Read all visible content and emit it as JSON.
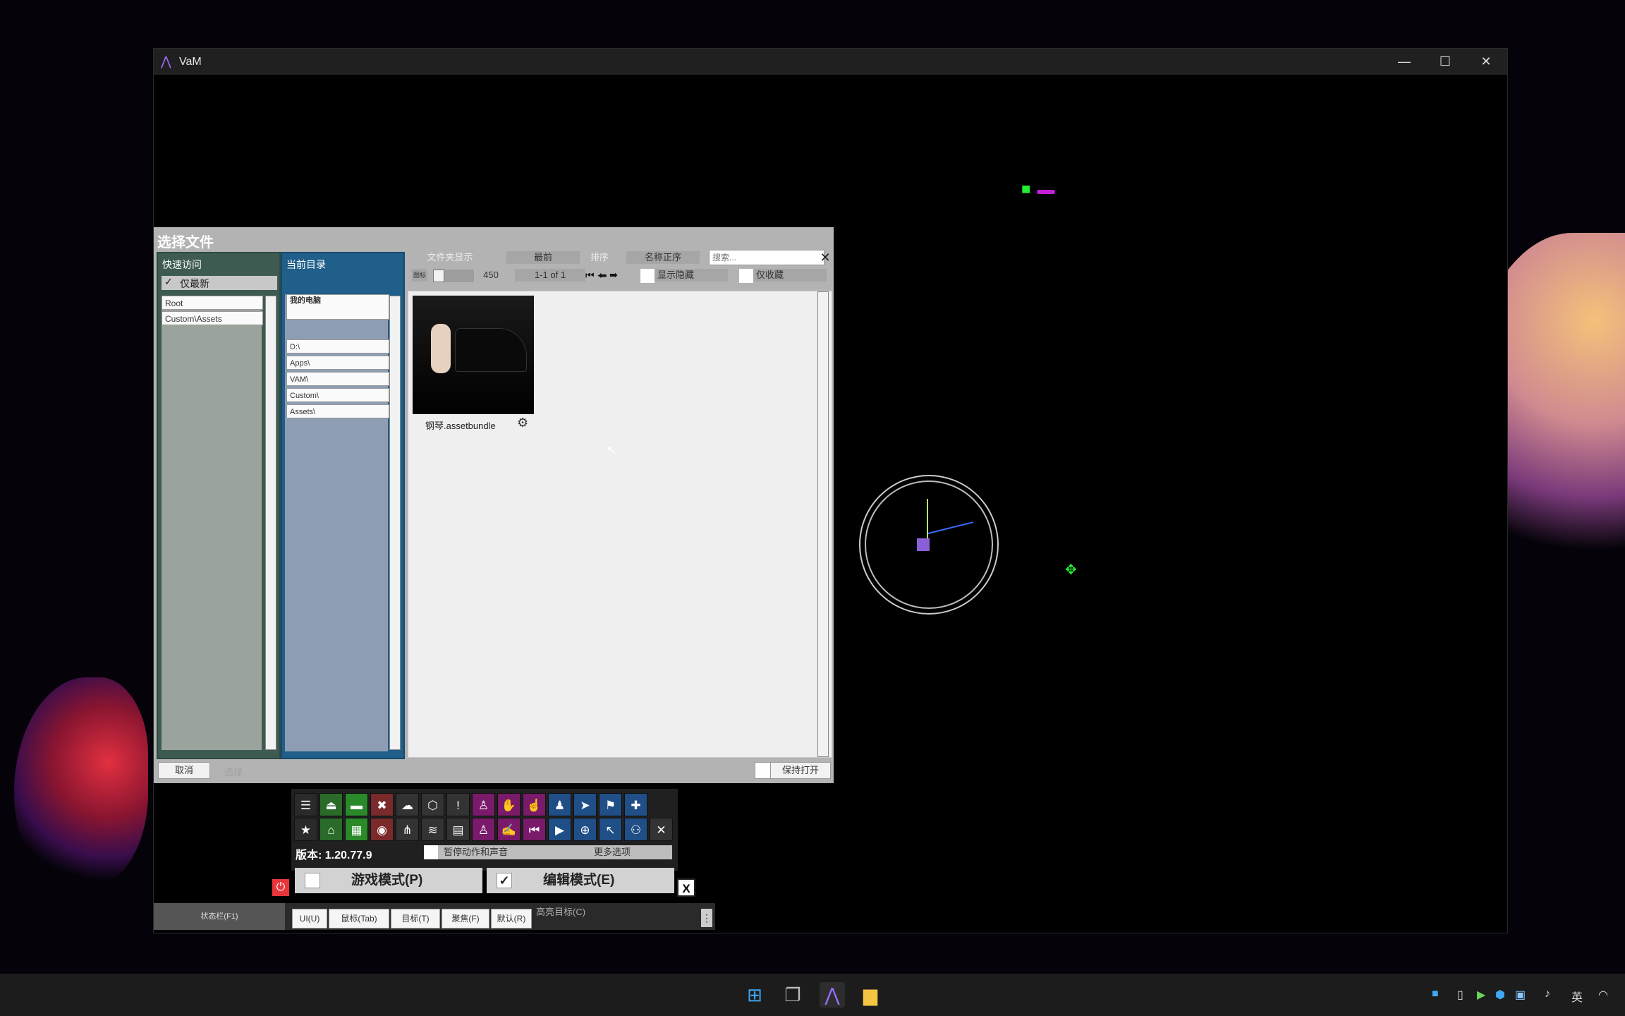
{
  "window": {
    "title": "VaM",
    "app_icon": "vam-logo-icon",
    "controls": [
      "minimize-icon",
      "maximize-icon",
      "close-icon"
    ]
  },
  "dialog": {
    "title": "选择文件",
    "quick_access": {
      "label": "快速访问",
      "checkbox_label": "仅最新",
      "checked": true,
      "items": [
        "Root",
        "Custom\\Assets"
      ]
    },
    "current_dir": {
      "label": "当前目录",
      "header_item": "我的电脑",
      "items": [
        "D:\\",
        "Apps\\",
        "VAM\\",
        "Custom\\",
        "Assets\\"
      ]
    },
    "toolbar": {
      "folder_view": "文件夹显示",
      "recent": "最前",
      "sort_label": "排序",
      "sort_value": "名称正序",
      "search_placeholder": "搜索...",
      "size_label": "图标",
      "size_value": "450",
      "page_info": "1-1 of 1",
      "show_hidden": "显示隐藏",
      "only_fav": "仅收藏"
    },
    "files": [
      {
        "name": "钢琴.assetbundle",
        "icon": "gear-icon"
      }
    ],
    "cancel": "取消",
    "select_label": "选择",
    "keep_open": "保持打开"
  },
  "panel": {
    "version": "版本: 1.20.77.9",
    "pause": "暂停动作和声音",
    "more": "更多选项",
    "play_mode": "游戏模式(P)",
    "edit_mode": "编辑模式(E)",
    "edit_checked": true,
    "close": "X",
    "icons_row1": [
      "menu-icon",
      "open-scene-icon",
      "folder-icon",
      "delete-icon",
      "cloud-upload-icon",
      "package-icon",
      "alert-icon",
      "person-add-icon",
      "hand-icon",
      "pointer-hand-icon",
      "person-icon",
      "send-icon",
      "flag-icon",
      "plus-icon"
    ],
    "icons_row2": [
      "star-icon",
      "open-folder-icon",
      "gallery-icon",
      "camera-icon",
      "share-icon",
      "layers-icon",
      "document-icon",
      "person-remove-icon",
      "wrench-hand-icon",
      "skip-back-icon",
      "play-icon",
      "target-icon",
      "cursor-icon",
      "people-icon",
      "tools-icon"
    ]
  },
  "statusbar": {
    "status_label": "状态栏(F1)",
    "buttons": [
      "UI(U)",
      "鼠标(Tab)",
      "目标(T)",
      "聚焦(F)",
      "默认(R)"
    ],
    "highlight": "高亮目标(C)"
  },
  "taskbar": {
    "icons": [
      "windows-start-icon",
      "task-view-icon",
      "vam-app-icon",
      "file-explorer-icon"
    ],
    "tray_lang": "英"
  }
}
